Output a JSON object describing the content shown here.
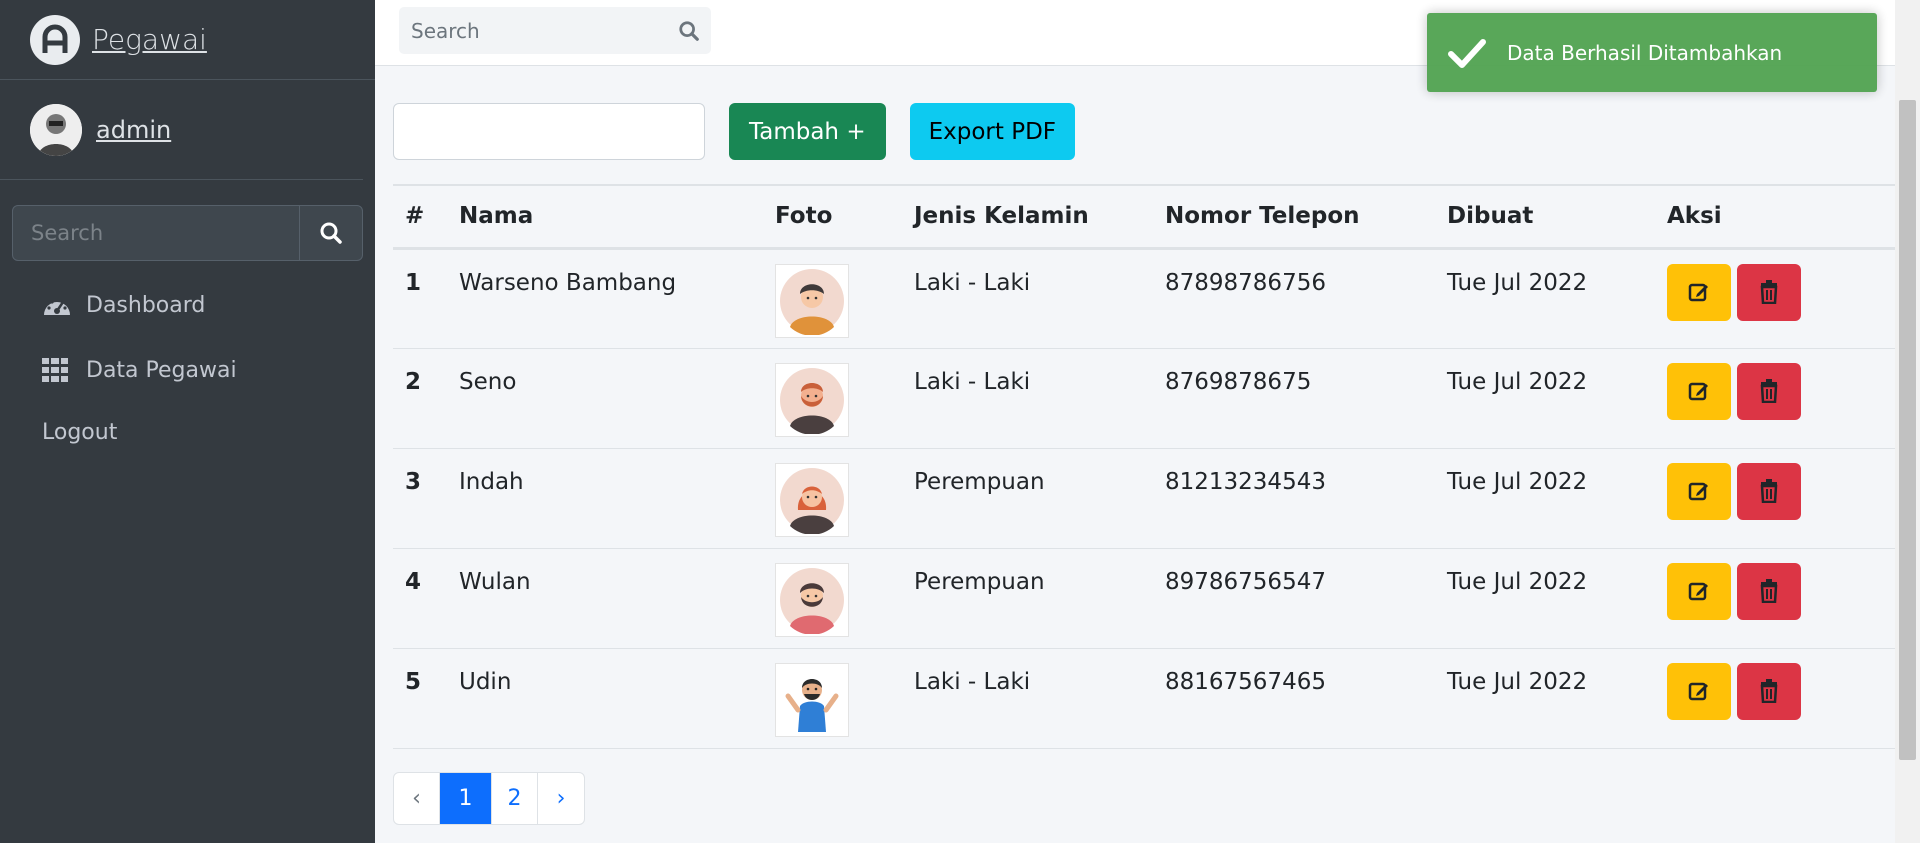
{
  "sidebar": {
    "brand": "Pegawai",
    "user": "admin",
    "search_placeholder": "Search",
    "nav": [
      {
        "label": "Dashboard",
        "icon": "gauge-icon"
      },
      {
        "label": "Data Pegawai",
        "icon": "grid-icon"
      }
    ],
    "logout": "Logout"
  },
  "topbar": {
    "search_placeholder": "Search"
  },
  "toolbar": {
    "add_label": "Tambah +",
    "export_label": "Export PDF"
  },
  "table": {
    "headers": [
      "#",
      "Nama",
      "Foto",
      "Jenis Kelamin",
      "Nomor Telepon",
      "Dibuat",
      "Aksi"
    ],
    "rows": [
      {
        "no": "1",
        "nama": "Warseno Bambang",
        "jk": "Laki - Laki",
        "telp": "87898786756",
        "dibuat": "Tue Jul 2022"
      },
      {
        "no": "2",
        "nama": "Seno",
        "jk": "Laki - Laki",
        "telp": "8769878675",
        "dibuat": "Tue Jul 2022"
      },
      {
        "no": "3",
        "nama": "Indah",
        "jk": "Perempuan",
        "telp": "81213234543",
        "dibuat": "Tue Jul 2022"
      },
      {
        "no": "4",
        "nama": "Wulan",
        "jk": "Perempuan",
        "telp": "89786756547",
        "dibuat": "Tue Jul 2022"
      },
      {
        "no": "5",
        "nama": "Udin",
        "jk": "Laki - Laki",
        "telp": "88167567465",
        "dibuat": "Tue Jul 2022"
      }
    ]
  },
  "pagination": {
    "prev": "‹",
    "pages": [
      "1",
      "2"
    ],
    "next": "›",
    "current": "1"
  },
  "toast": {
    "message": "Data Berhasil Ditambahkan"
  },
  "colors": {
    "sidebar_bg": "#343a40",
    "btn_add": "#198754",
    "btn_export": "#0dcaf0",
    "btn_edit": "#ffc107",
    "btn_delete": "#dc3545",
    "toast": "#51a351",
    "page_active": "#0d6efd"
  }
}
